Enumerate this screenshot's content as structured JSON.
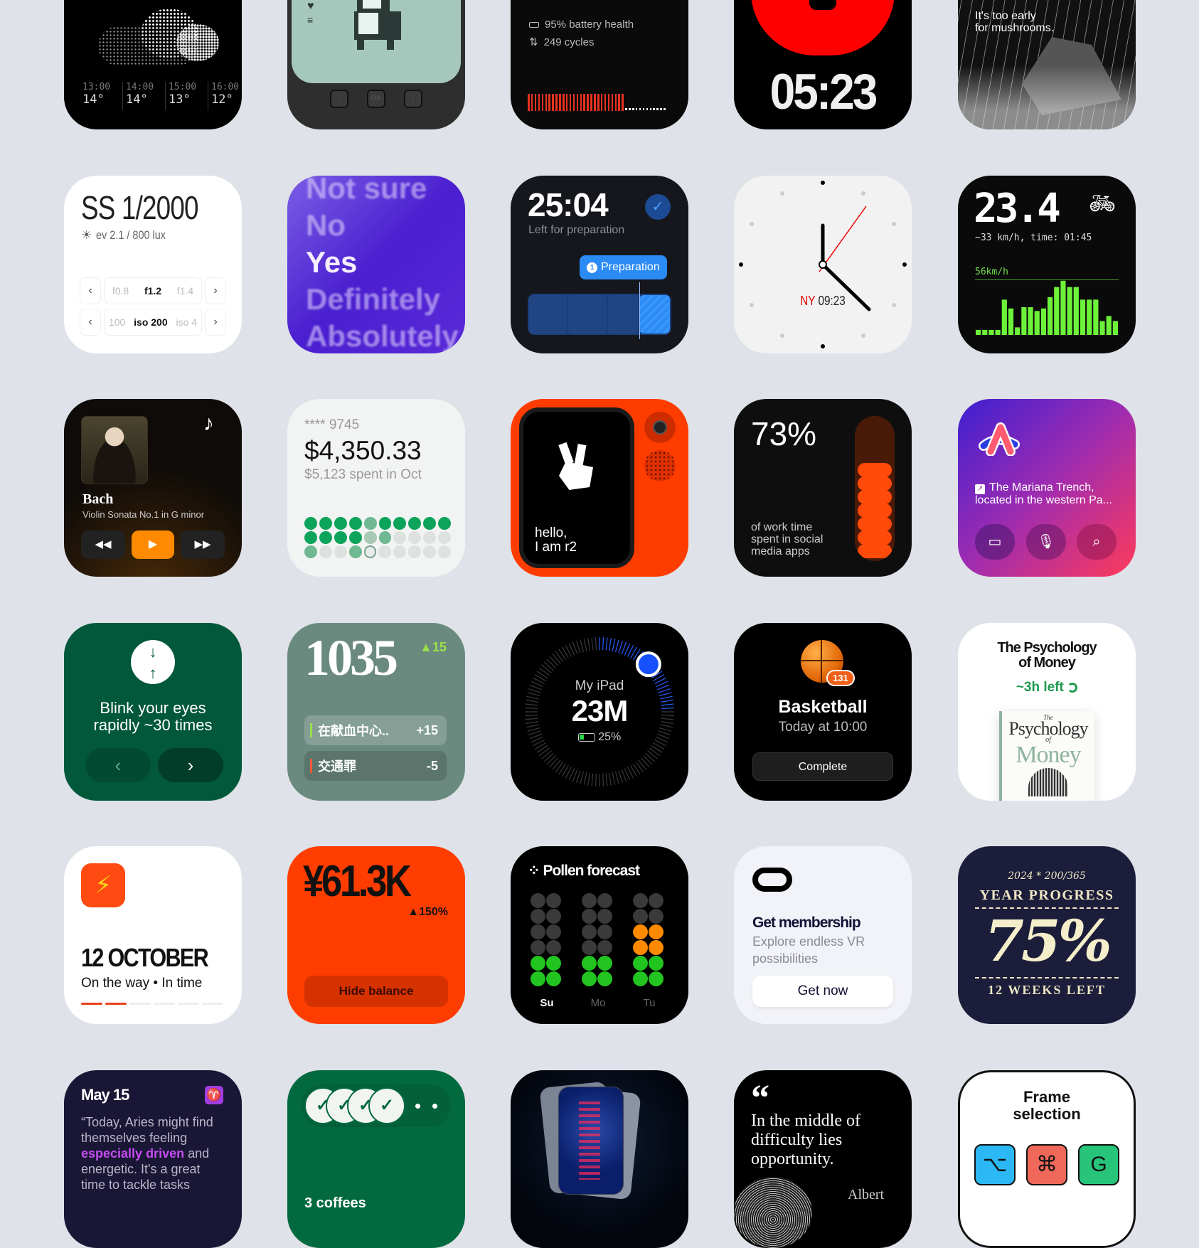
{
  "weather": {
    "hours": [
      {
        "time": "13:00",
        "temp": "14°"
      },
      {
        "time": "14:00",
        "temp": "14°"
      },
      {
        "time": "15:00",
        "temp": "13°"
      },
      {
        "time": "16:00",
        "temp": "12°"
      }
    ]
  },
  "pet": {
    "buttons": [
      "‹",
      "OK",
      "›"
    ]
  },
  "battery": {
    "health": "95% battery health",
    "cycles": "249 cycles",
    "level": 0.69
  },
  "timer": {
    "time": "05:23",
    "accent": "#ff0000"
  },
  "mushroom": {
    "line1": "It's too early",
    "line2": "for mushrooms."
  },
  "camera": {
    "shutter": "SS 1/2000",
    "ev": "ev 2.1 / 800 lux",
    "aperture": {
      "prev": "f0.8",
      "current": "f1.2",
      "next": "f1.4"
    },
    "iso": {
      "prev": "100",
      "current": "iso 200",
      "next": "iso 4"
    },
    "left_arrow": "‹",
    "right_arrow": "›"
  },
  "magic8": {
    "items": [
      "Not sure",
      "No",
      "Yes",
      "Definitely",
      "Absolutely"
    ],
    "selected": "Yes"
  },
  "prep": {
    "time": "25:04",
    "subtitle": "Left for preparation",
    "badge_num": "1",
    "badge_label": "Preparation",
    "progress": 0.8
  },
  "clock": {
    "city": "NY",
    "time": "09:23"
  },
  "cycling": {
    "distance": "23.4",
    "stats": "~33 km/h, time: 01:45",
    "max_label": "56km/h",
    "bars": [
      4,
      4,
      4,
      4,
      28,
      21,
      6,
      22,
      22,
      19,
      21,
      30,
      38,
      43,
      38,
      38,
      28,
      28,
      28,
      11,
      15,
      11
    ]
  },
  "music": {
    "artist": "Bach",
    "track": "Violin Sonata No.1 in G minor",
    "accent": "#ff8a00"
  },
  "bank": {
    "card": "**** 9745",
    "balance": "$4,350.33",
    "spent": "$5,123 spent in Oct",
    "dots": [
      [
        2,
        2,
        2,
        2,
        1,
        2,
        2,
        2,
        2,
        2
      ],
      [
        2,
        2,
        2,
        2,
        0.5,
        1,
        0,
        0,
        0,
        0
      ],
      [
        1,
        0,
        0,
        1,
        -1,
        0,
        0,
        0,
        0,
        0
      ]
    ]
  },
  "r1": {
    "greeting_1": "hello,",
    "greeting_2": "I am r2"
  },
  "screentime": {
    "percent": "73%",
    "desc": [
      "of work time",
      "spent in social",
      "media apps"
    ],
    "value": 0.73
  },
  "arc": {
    "text_1": "The Mariana Trench,",
    "text_2": "located in the western Pa..."
  },
  "blink": {
    "line1": "Blink your eyes",
    "line2": "rapidly ~30 times",
    "prev": "‹",
    "next": "›"
  },
  "credit": {
    "score": "1035",
    "delta": "▲15",
    "items": [
      {
        "label": "在献血中心..",
        "value": "+15",
        "color": "#9be04a"
      },
      {
        "label": "交通罪",
        "value": "-5",
        "color": "#ff5a36"
      }
    ]
  },
  "ipad": {
    "name": "My iPad",
    "value": "23M",
    "battery": "25%",
    "progress": 0.25
  },
  "basketball": {
    "title": "Basketball",
    "time": "Today at 10:00",
    "badge": "131",
    "button": "Complete"
  },
  "book": {
    "title_1": "The Psychology",
    "title_2": "of Money",
    "left": "~3h left",
    "cover_the": "The",
    "cover_1": "Psychology",
    "cover_of": "of",
    "cover_2": "Money"
  },
  "event": {
    "date": "12 OCTOBER",
    "status": "On the way • In time",
    "steps_done": 2,
    "steps_total": 6
  },
  "yen": {
    "amount": "¥61.3K",
    "change": "▲150%",
    "button": "Hide balance"
  },
  "pollen": {
    "title": "Pollen forecast",
    "days": [
      {
        "label": "Su",
        "level": 2,
        "color": "#22c41f"
      },
      {
        "label": "Mo",
        "level": 2,
        "color": "#22c41f"
      },
      {
        "label": "Tu",
        "level": 3,
        "color": "#ff8a00"
      }
    ]
  },
  "vr": {
    "title": "Get membership",
    "desc_1": "Explore endless VR",
    "desc_2": "possibilities",
    "button": "Get now"
  },
  "year": {
    "top": "2024 * 200/365",
    "title": "YEAR PROGRESS",
    "percent": "75%",
    "weeks": "12 WEEKS LEFT"
  },
  "horoscope": {
    "date": "May 15",
    "sign": "♈",
    "text_before": "“Today, Aries might find themselves feeling ",
    "highlight": "especially driven",
    "text_after": " and energetic. It's a great time to tackle tasks"
  },
  "coffee": {
    "checks": 4,
    "remaining": 2,
    "label": "3 coffees"
  },
  "quote": {
    "mark": "“",
    "text": "In the middle of difficulty lies opportunity.",
    "author": "Albert"
  },
  "shortcut": {
    "title_1": "Frame",
    "title_2": "selection",
    "keys": [
      {
        "glyph": "⌥",
        "color": "#2bb8f5"
      },
      {
        "glyph": "⌘",
        "color": "#f0685a"
      },
      {
        "glyph": "G",
        "color": "#27c47a"
      }
    ]
  }
}
